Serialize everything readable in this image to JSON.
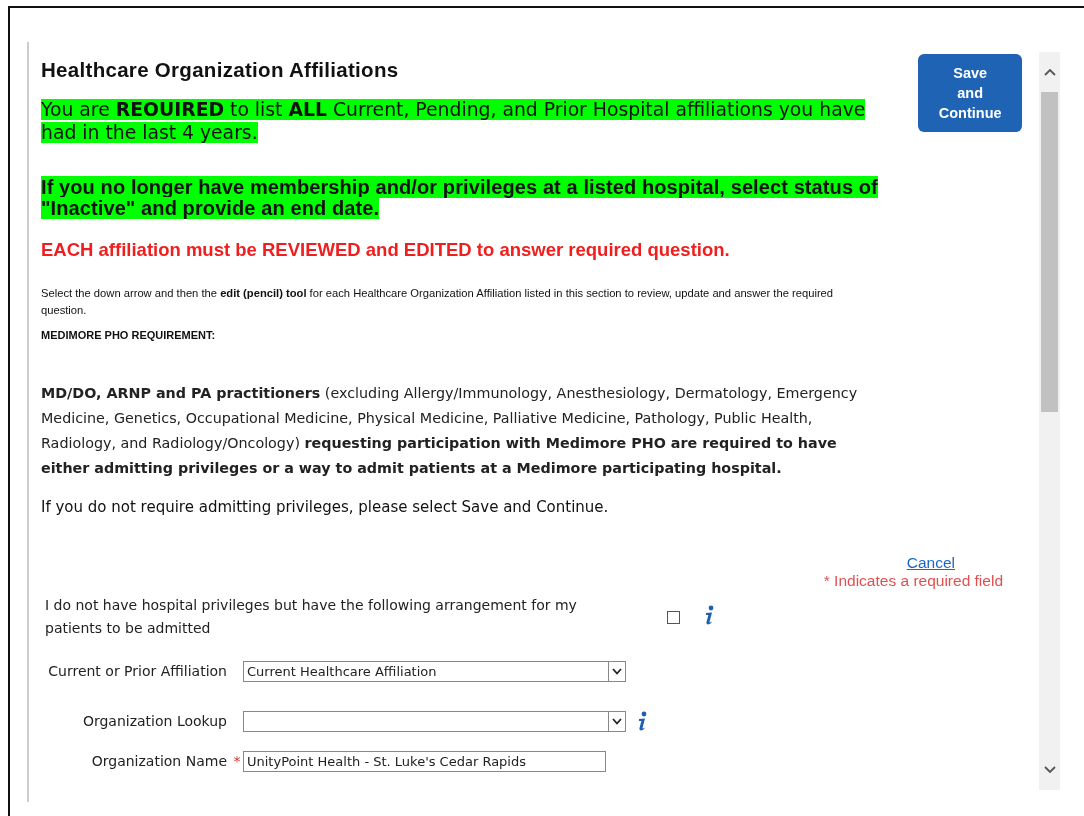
{
  "title": "Healthcare Organization Affiliations",
  "save_button": "Save and Continue",
  "notices": [
    {
      "kind": "highlight",
      "text": "You are **REOUIRED** to list **ALL** Current, Pending, and Prior Hospital affiliations you have had in the last 4 years."
    },
    {
      "kind": "highlight-bold",
      "text": "If you no longer have membership and/or privileges at a listed hospital, select status of \"Inactive\" and provide an end date."
    },
    {
      "kind": "alert",
      "text": "EACH affiliation must be REVIEWED and EDITED to answer required question."
    },
    {
      "kind": "small",
      "text": "Select the down arrow and then the **edit (pencil) tool** for each Healthcare Organization Affiliation listed in this section to review, update and answer the required question."
    },
    {
      "kind": "small-bold",
      "text": "MEDIMORE PHO REQUIREMENT:"
    },
    {
      "kind": "body",
      "text": "**MD/DO, ARNP and PA practitioners** (excluding Allergy/Immunology, Anesthesiology, Dermatology, Emergency Medicine, Genetics, Occupational Medicine, Physical Medicine, Palliative Medicine, Pathology, Public Health, Radiology, and Radiology/Oncology) **requesting participation with Medimore PHO are required to have either admitting privileges or a way to admit patients at a Medimore participating hospital.**"
    },
    {
      "kind": "plain",
      "text": "If you do not require admitting privileges, please select Save and Continue."
    }
  ],
  "cancel_link": "Cancel",
  "required_note": "* Indicates a required field",
  "arrangement": {
    "label": "I do not have hospital privileges but have the following arrangement for my patients to be admitted",
    "checked": false,
    "info": true
  },
  "fields": [
    {
      "kind": "select",
      "label": "Current or Prior Affiliation",
      "value": "Current Healthcare Affiliation",
      "info": false
    },
    {
      "kind": "select",
      "label": "Organization Lookup",
      "info": true
    },
    {
      "kind": "text",
      "label": "Organization Name",
      "required_mark": "*",
      "value": "UnityPoint Health - St. Luke's Cedar Rapids",
      "info": false
    }
  ]
}
